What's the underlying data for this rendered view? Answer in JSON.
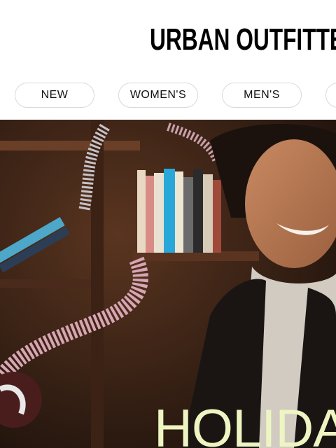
{
  "header": {
    "logo_text": "URBAN OUTFITTERS"
  },
  "nav": {
    "items": [
      {
        "label": "NEW"
      },
      {
        "label": "WOMEN'S"
      },
      {
        "label": "MEN'S"
      },
      {
        "label": ""
      }
    ]
  },
  "hero": {
    "headline": "HOLIDAY",
    "headline_color": "#eef5c2"
  }
}
